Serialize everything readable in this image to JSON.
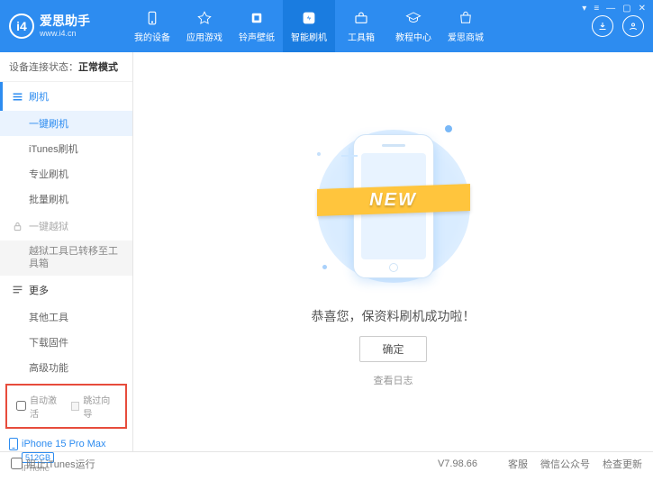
{
  "header": {
    "logo_title": "爱思助手",
    "logo_sub": "www.i4.cn",
    "nav": [
      {
        "label": "我的设备",
        "icon": "phone"
      },
      {
        "label": "应用游戏",
        "icon": "app"
      },
      {
        "label": "铃声壁纸",
        "icon": "ringtone"
      },
      {
        "label": "智能刷机",
        "icon": "flash",
        "active": true
      },
      {
        "label": "工具箱",
        "icon": "toolbox"
      },
      {
        "label": "教程中心",
        "icon": "tutorial"
      },
      {
        "label": "爱思商城",
        "icon": "shop"
      }
    ]
  },
  "sidebar": {
    "conn_label": "设备连接状态：",
    "conn_status": "正常模式",
    "group_flash": "刷机",
    "items_flash": [
      "一键刷机",
      "iTunes刷机",
      "专业刷机",
      "批量刷机"
    ],
    "group_jailbreak": "一键越狱",
    "jailbreak_note": "越狱工具已转移至工具箱",
    "group_more": "更多",
    "items_more": [
      "其他工具",
      "下载固件",
      "高级功能"
    ],
    "chk_auto_activate": "自动激活",
    "chk_skip_guide": "跳过向导",
    "device_name": "iPhone 15 Pro Max",
    "device_storage": "512GB",
    "device_type": "iPhone"
  },
  "main": {
    "ribbon_text": "NEW",
    "success_text": "恭喜您，保资料刷机成功啦！",
    "ok_button": "确定",
    "view_log": "查看日志"
  },
  "footer": {
    "block_itunes": "阻止iTunes运行",
    "version": "V7.98.66",
    "links": [
      "客服",
      "微信公众号",
      "检查更新"
    ]
  }
}
